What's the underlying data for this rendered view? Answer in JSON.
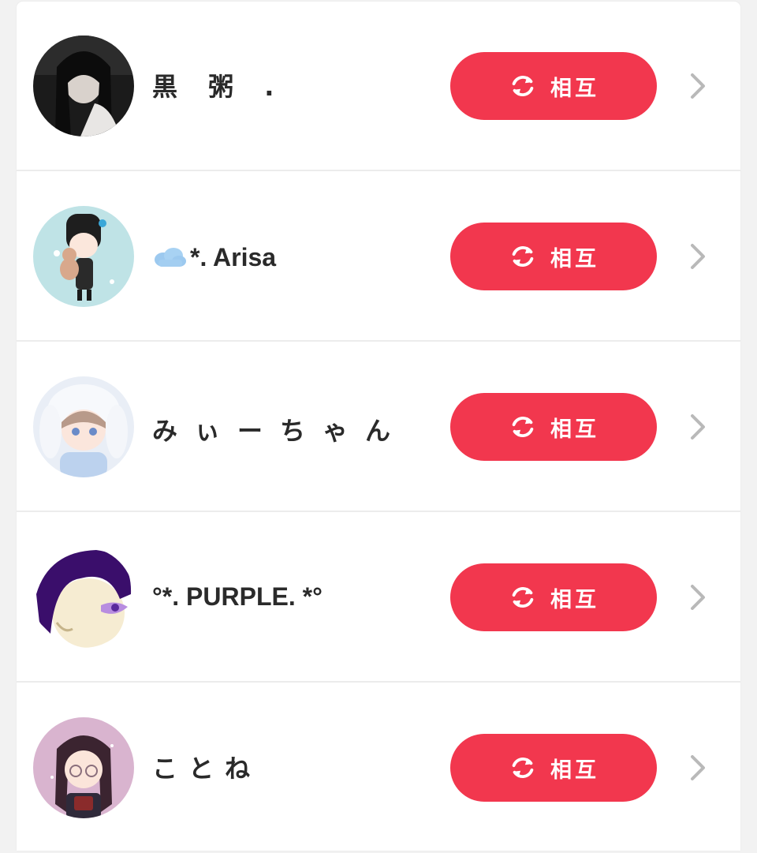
{
  "colors": {
    "accent": "#f2374e",
    "chevron": "#b9b9b9",
    "background": "#f2f2f2"
  },
  "users": [
    {
      "name": "黒 粥 .",
      "button_label": "相互",
      "button_icon": "refresh-icon"
    },
    {
      "name": "*. Arisa",
      "name_prefix_icon": "cloud-icon",
      "button_label": "相互",
      "button_icon": "refresh-icon"
    },
    {
      "name": "みぃーちゃん",
      "button_label": "相互",
      "button_icon": "refresh-icon"
    },
    {
      "name": "°*. PURPLE. *°",
      "button_label": "相互",
      "button_icon": "refresh-icon"
    },
    {
      "name": "ことね",
      "button_label": "相互",
      "button_icon": "refresh-icon"
    }
  ]
}
